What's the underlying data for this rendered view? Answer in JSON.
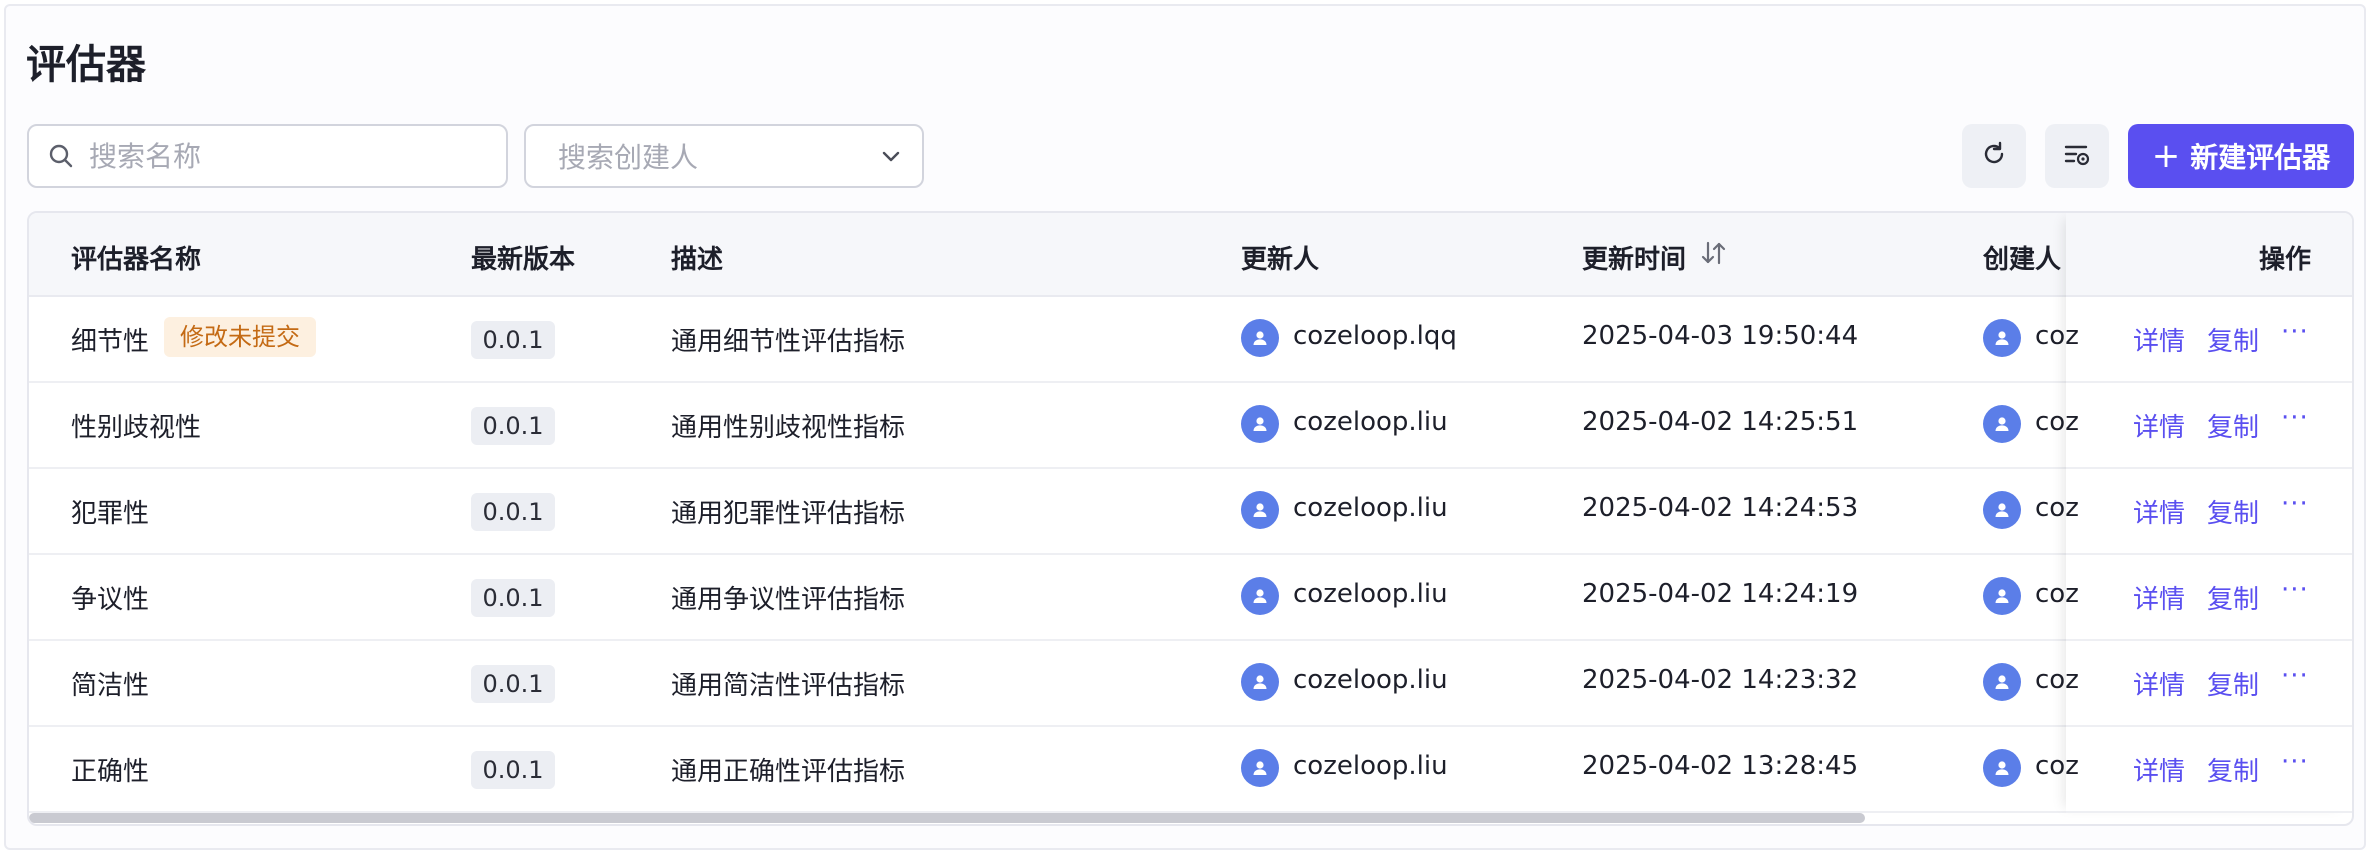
{
  "page": {
    "title": "评估器"
  },
  "toolbar": {
    "search_placeholder": "搜索名称",
    "creator_placeholder": "搜索创建人",
    "refresh_icon": "refresh-icon",
    "column_settings_icon": "column-settings-icon",
    "new_button_label": "新建评估器",
    "new_button_plus": "+"
  },
  "table": {
    "headers": {
      "name": "评估器名称",
      "version": "最新版本",
      "description": "描述",
      "updater": "更新人",
      "updated_at": "更新时间",
      "creator": "创建人",
      "actions": "操作"
    },
    "rows": [
      {
        "name": "细节性",
        "status_tag": "修改未提交",
        "version": "0.0.1",
        "description": "通用细节性评估指标",
        "updater": "cozeloop.lqq",
        "updated_at": "2025-04-03 19:50:44",
        "creator": "coz"
      },
      {
        "name": "性别歧视性",
        "status_tag": "",
        "version": "0.0.1",
        "description": "通用性别歧视性指标",
        "updater": "cozeloop.liu",
        "updated_at": "2025-04-02 14:25:51",
        "creator": "coz"
      },
      {
        "name": "犯罪性",
        "status_tag": "",
        "version": "0.0.1",
        "description": "通用犯罪性评估指标",
        "updater": "cozeloop.liu",
        "updated_at": "2025-04-02 14:24:53",
        "creator": "coz"
      },
      {
        "name": "争议性",
        "status_tag": "",
        "version": "0.0.1",
        "description": "通用争议性评估指标",
        "updater": "cozeloop.liu",
        "updated_at": "2025-04-02 14:24:19",
        "creator": "coz"
      },
      {
        "name": "简洁性",
        "status_tag": "",
        "version": "0.0.1",
        "description": "通用简洁性评估指标",
        "updater": "cozeloop.liu",
        "updated_at": "2025-04-02 14:23:32",
        "creator": "coz"
      },
      {
        "name": "正确性",
        "status_tag": "",
        "version": "0.0.1",
        "description": "通用正确性评估指标",
        "updater": "cozeloop.liu",
        "updated_at": "2025-04-02 13:28:45",
        "creator": "coz"
      }
    ],
    "actions": {
      "detail": "详情",
      "copy": "复制",
      "more": "···"
    }
  },
  "colors": {
    "primary": "#5a4ff0",
    "avatar": "#5b7ee8",
    "warning_tag_bg": "#fdf0e0",
    "warning_tag_text": "#c46a14"
  }
}
